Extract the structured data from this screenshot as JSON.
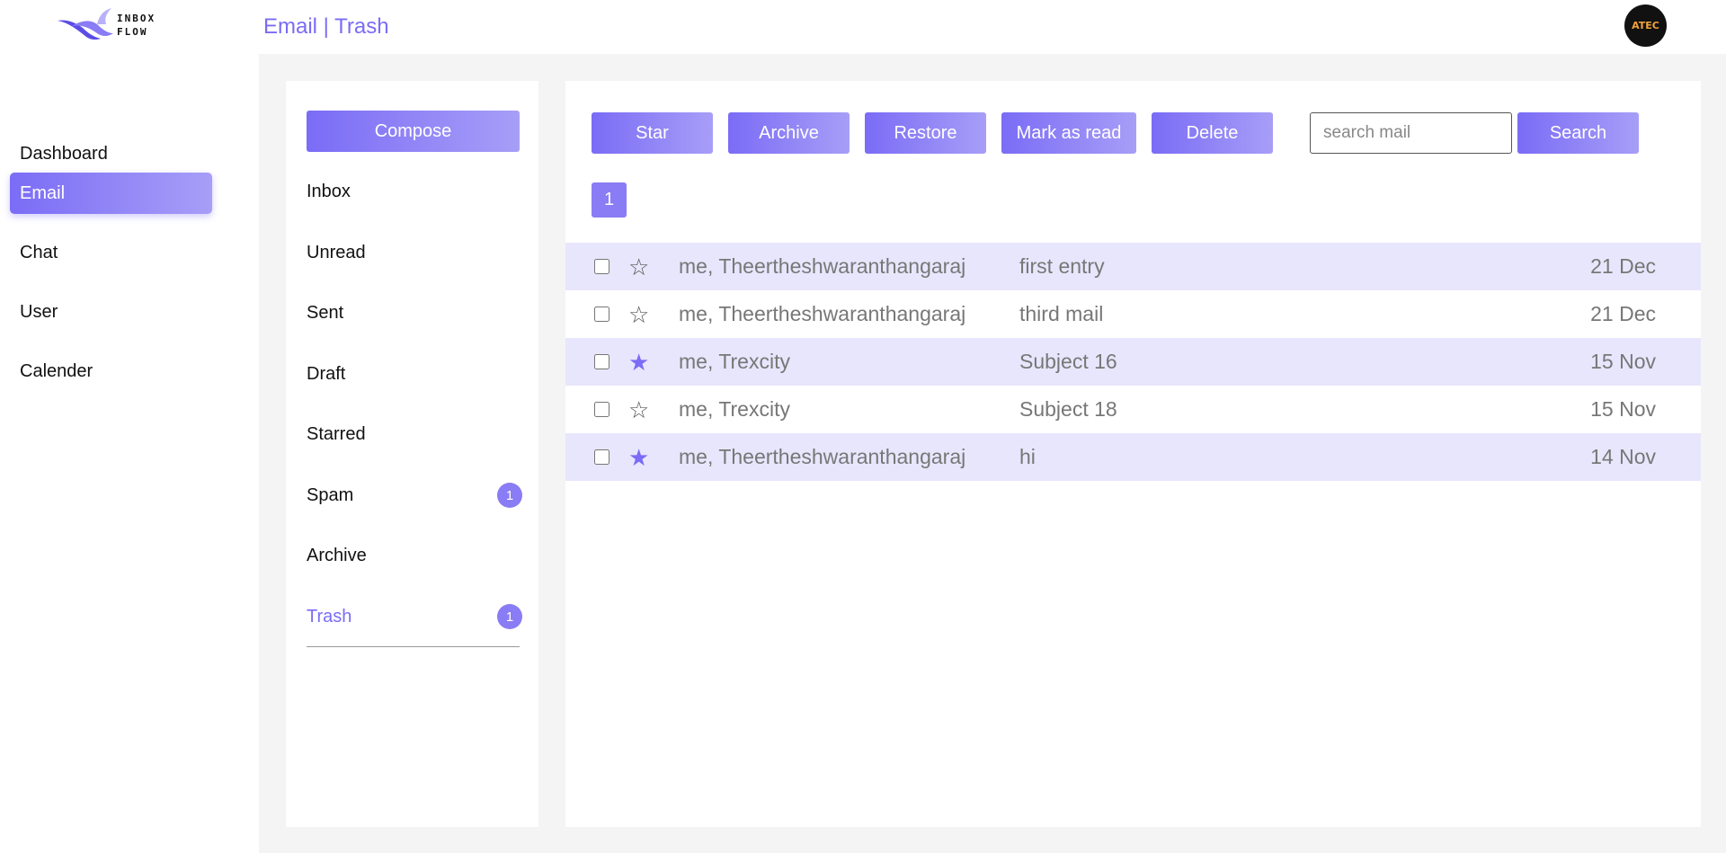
{
  "brand": {
    "line1": "INBOX",
    "line2": "FLOW"
  },
  "header": {
    "title": "Email | Trash"
  },
  "user": {
    "avatar_text": "ATEC"
  },
  "sidebar": {
    "items": [
      {
        "label": "Dashboard"
      },
      {
        "label": "Email",
        "active": true
      },
      {
        "label": "Chat"
      },
      {
        "label": "User"
      },
      {
        "label": "Calender"
      }
    ]
  },
  "folders": {
    "compose_label": "Compose",
    "items": [
      {
        "label": "Inbox"
      },
      {
        "label": "Unread"
      },
      {
        "label": "Sent"
      },
      {
        "label": "Draft"
      },
      {
        "label": "Starred"
      },
      {
        "label": "Spam",
        "count": "1"
      },
      {
        "label": "Archive"
      },
      {
        "label": "Trash",
        "count": "1",
        "active": true
      }
    ]
  },
  "toolbar": {
    "star_label": "Star",
    "archive_label": "Archive",
    "restore_label": "Restore",
    "mark_read_label": "Mark as read",
    "delete_label": "Delete",
    "search_placeholder": "search mail",
    "search_value": "",
    "search_label": "Search"
  },
  "pagination": {
    "current": "1"
  },
  "mails": [
    {
      "sender": "me, Theertheshwaranthangaraj",
      "subject": "first entry",
      "date": "21 Dec",
      "starred": false,
      "checked": false
    },
    {
      "sender": "me, Theertheshwaranthangaraj",
      "subject": "third mail",
      "date": "21 Dec",
      "starred": false,
      "checked": false
    },
    {
      "sender": "me, Trexcity",
      "subject": "Subject 16",
      "date": "15 Nov",
      "starred": true,
      "checked": false
    },
    {
      "sender": "me, Trexcity",
      "subject": "Subject 18",
      "date": "15 Nov",
      "starred": false,
      "checked": false
    },
    {
      "sender": "me, Theertheshwaranthangaraj",
      "subject": "hi",
      "date": "14 Nov",
      "starred": true,
      "checked": false
    }
  ],
  "colors": {
    "accent": "#7b6cf6",
    "accent_light": "#a79ef7",
    "row_highlight": "#e8e6fc",
    "content_bg": "#f4f4f4"
  },
  "icons": {
    "star_empty": "star-outline-icon",
    "star_filled": "star-filled-icon",
    "logo": "bird-logo-icon"
  }
}
